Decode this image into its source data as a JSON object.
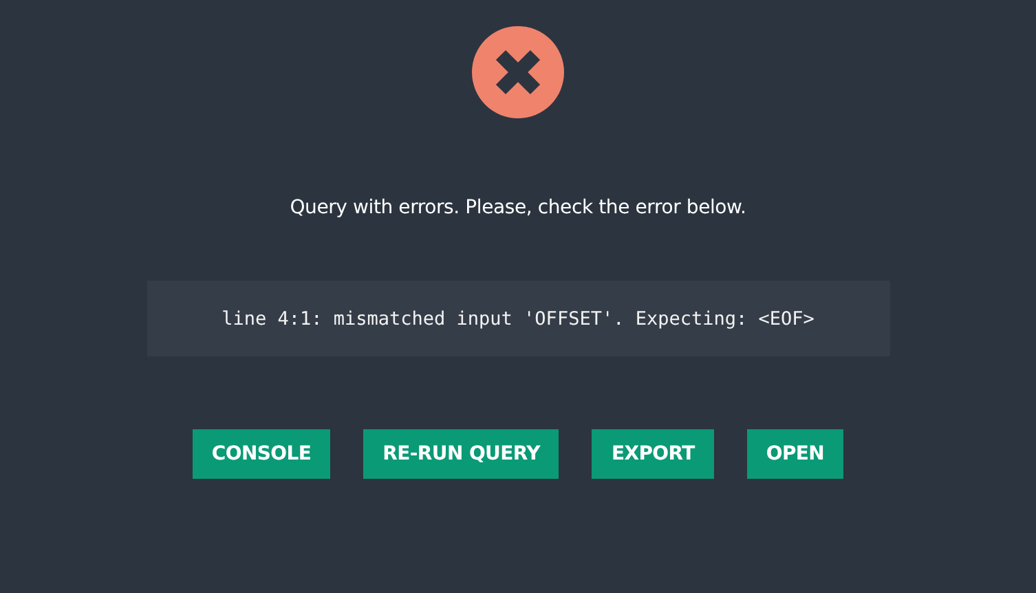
{
  "message": "Query with errors. Please, check the error below.",
  "error": "line 4:1: mismatched input 'OFFSET'. Expecting: <EOF>",
  "buttons": [
    "CONSOLE",
    "RE-RUN QUERY",
    "EXPORT",
    "OPEN"
  ]
}
